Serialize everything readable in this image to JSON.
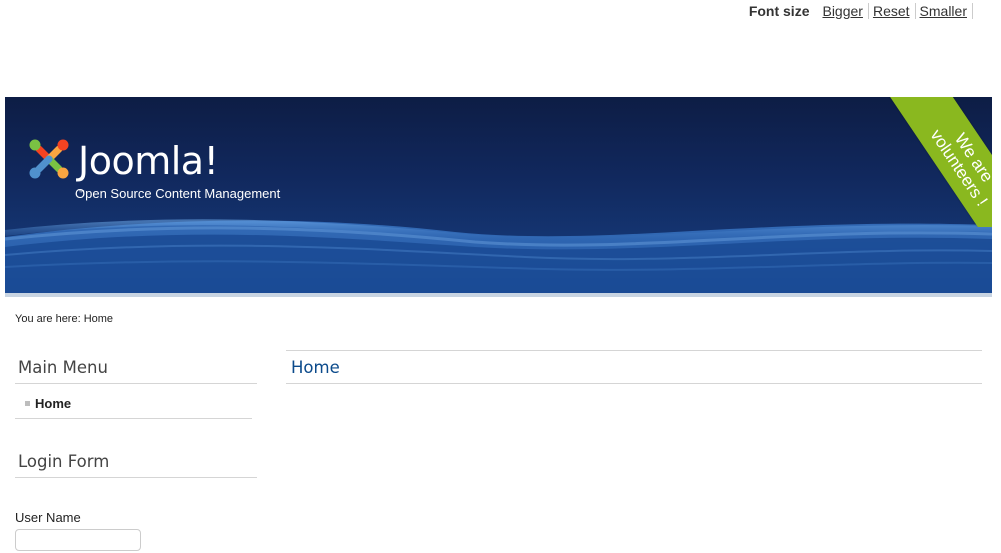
{
  "font_size": {
    "label": "Font size",
    "bigger": "Bigger",
    "reset": "Reset",
    "smaller": "Smaller"
  },
  "header": {
    "logo_text": "Joomla!",
    "logo_tm": "™",
    "tagline": "Open Source Content Management",
    "ribbon_line1": "We are",
    "ribbon_line2": "volunteers !",
    "ribbon_color": "#8ab81f"
  },
  "breadcrumb": {
    "text": "You are here:  Home"
  },
  "sidebar": {
    "main_menu": {
      "title": "Main Menu",
      "items": [
        {
          "label": "Home"
        }
      ]
    },
    "login_form": {
      "title": "Login Form",
      "username_label": "User Name",
      "username_value": ""
    }
  },
  "main": {
    "title": "Home"
  },
  "colors": {
    "title_blue": "#0b4a8b",
    "header_dark": "#0d1d45"
  }
}
